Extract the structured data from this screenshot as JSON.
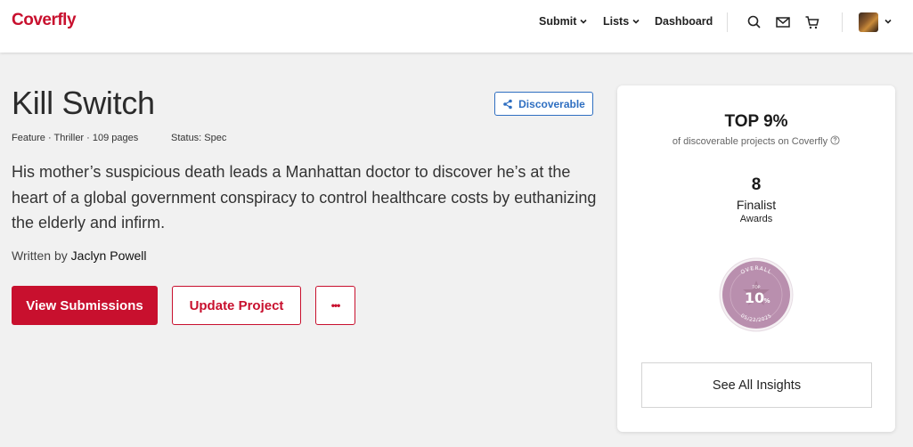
{
  "header": {
    "logo": "Coverfly",
    "nav": [
      {
        "label": "Submit"
      },
      {
        "label": "Lists"
      },
      {
        "label": "Dashboard"
      }
    ],
    "icons": [
      "search-icon",
      "mail-icon",
      "cart-icon",
      "avatar",
      "chevron-down-icon"
    ]
  },
  "project": {
    "title": "Kill Switch",
    "discoverable_label": "Discoverable",
    "meta": "Feature · Thriller · 109 pages",
    "status": "Status: Spec",
    "logline": "His mother’s suspicious death leads a Manhattan doctor to discover he’s at the heart of a global government conspiracy to control healthcare costs by euthanizing the elderly and infirm.",
    "written_by_label": "Written by",
    "writer": "Jaclyn Powell",
    "buttons": {
      "view_submissions": "View Submissions",
      "update_project": "Update Project",
      "more": "•••"
    }
  },
  "insights": {
    "top_pct": "TOP 9%",
    "top_sub": "of discoverable projects on Coverfly",
    "awards_count": "8",
    "awards_label": "Finalist",
    "awards_sub": "Awards",
    "badge": {
      "top_text": "OVERALL",
      "small": "TOP",
      "value": "10",
      "unit": "%",
      "date": "05/22/2025",
      "color": "#b98fae"
    },
    "see_all": "See All Insights"
  },
  "colors": {
    "brand": "#c8102e",
    "link": "#2f6fc1",
    "background": "#f1f1f1"
  }
}
